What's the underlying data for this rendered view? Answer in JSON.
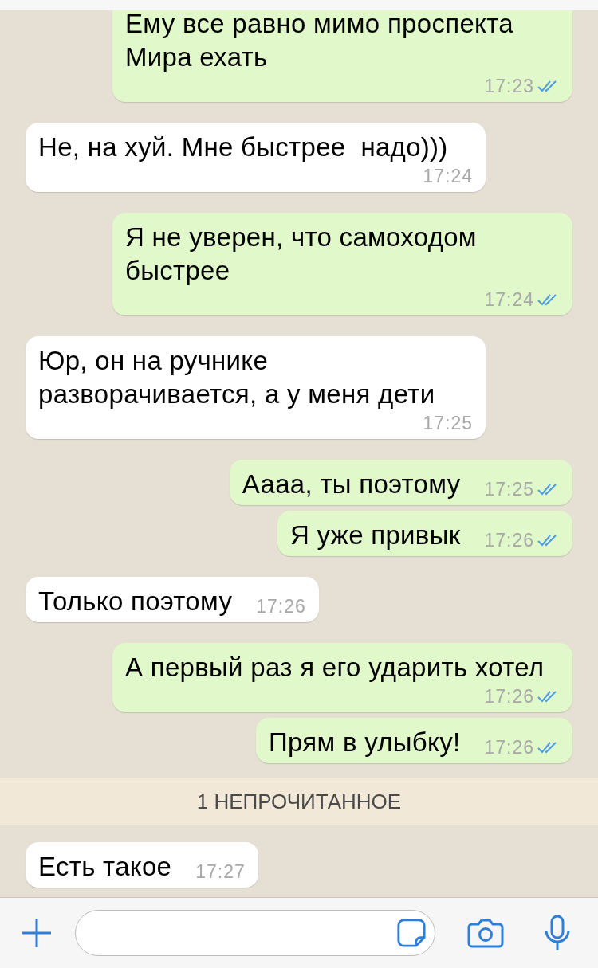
{
  "messages": [
    {
      "text": "Ему все равно мимо проспекта Мира ехать",
      "time": "17:23",
      "outgoing": true,
      "read": true
    },
    {
      "text": "Не, на хуй. Мне быстрее  надо)))",
      "time": "17:24",
      "outgoing": false
    },
    {
      "text": "Я не уверен, что самоходом быстрее",
      "time": "17:24",
      "outgoing": true,
      "read": true
    },
    {
      "text": "Юр, он на ручнике разворачивается, а у меня дети",
      "time": "17:25",
      "outgoing": false
    },
    {
      "text": "Аааа, ты поэтому",
      "time": "17:25",
      "outgoing": true,
      "read": true
    },
    {
      "text": "Я уже привык",
      "time": "17:26",
      "outgoing": true,
      "read": true
    },
    {
      "text": "Только поэтому",
      "time": "17:26",
      "outgoing": false
    },
    {
      "text": "А первый раз я его ударить хотел",
      "time": "17:26",
      "outgoing": true,
      "read": true
    },
    {
      "text": "Прям в улыбку!",
      "time": "17:26",
      "outgoing": true,
      "read": true
    }
  ],
  "unread_banner": "1 НЕПРОЧИТАННОЕ",
  "unread_messages": [
    {
      "text": "Есть такое",
      "time": "17:27",
      "outgoing": false
    }
  ]
}
